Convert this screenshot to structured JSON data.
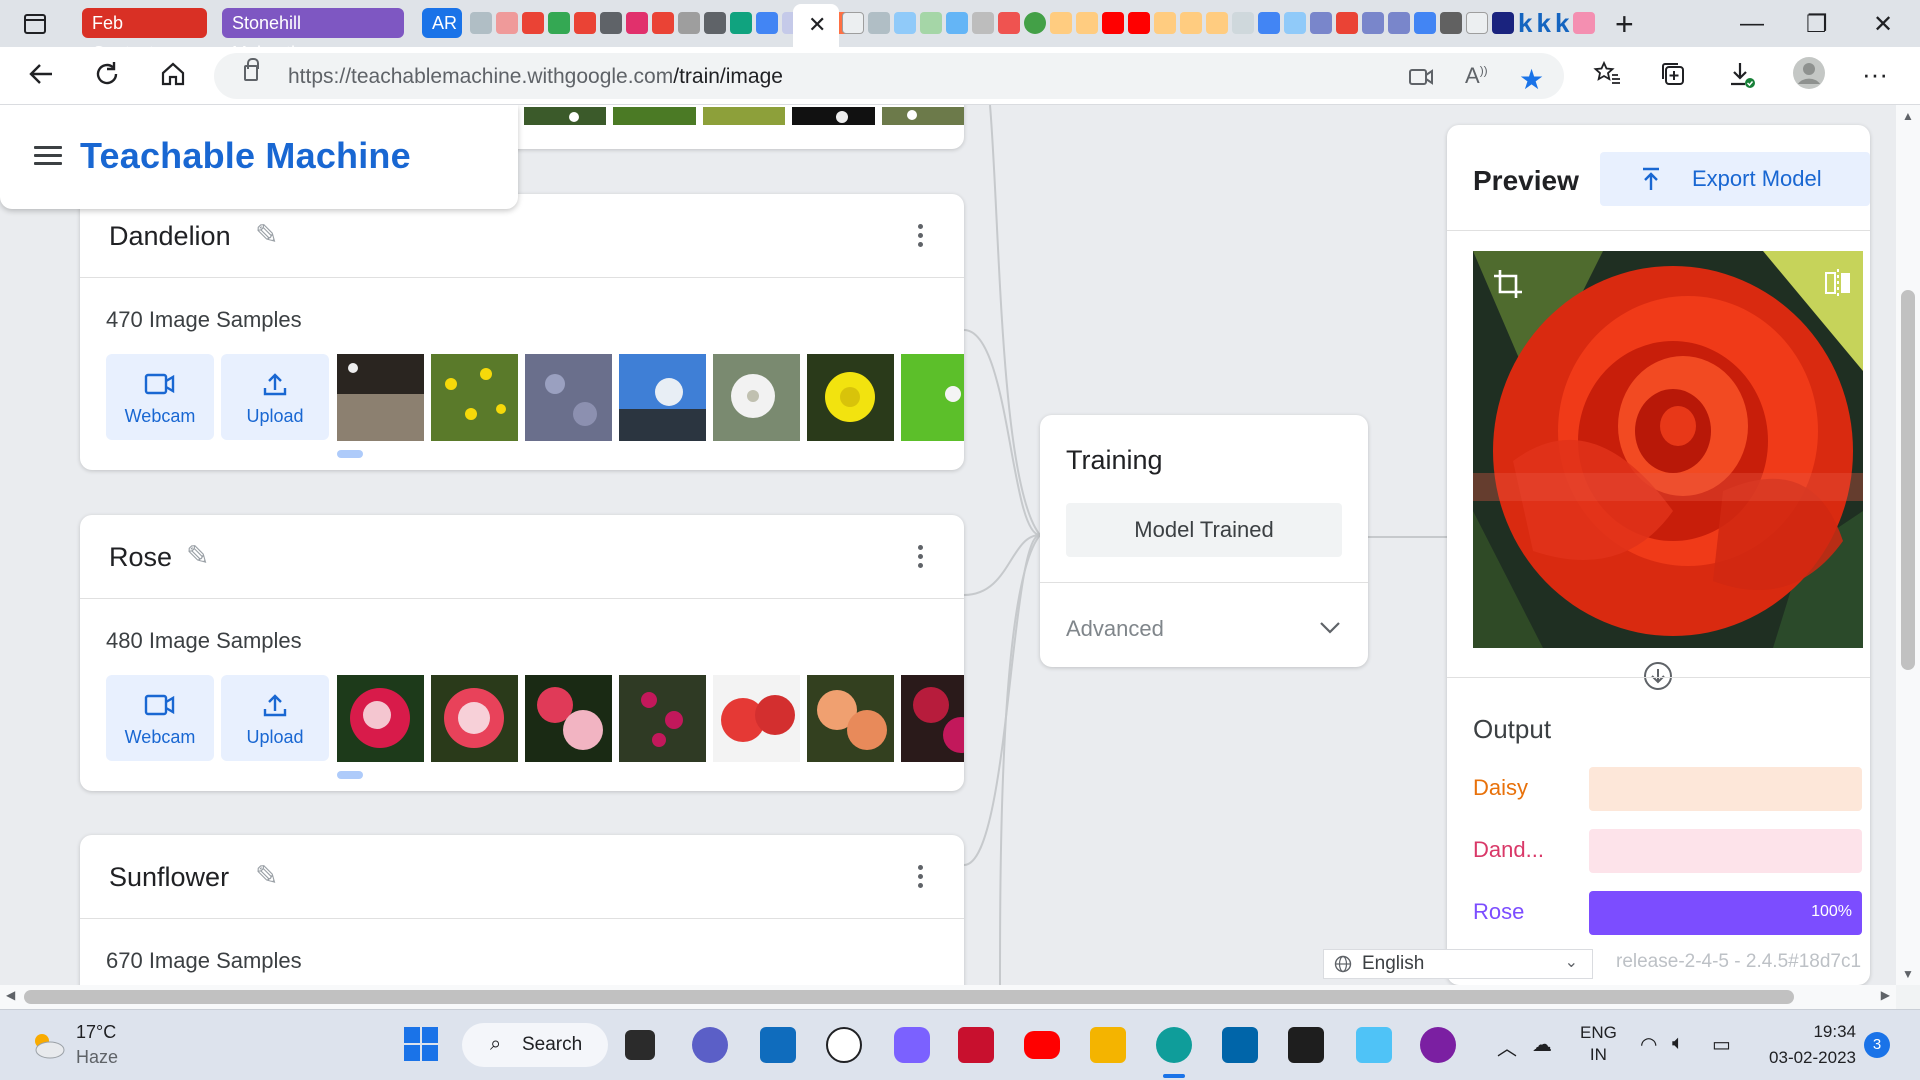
{
  "browser": {
    "tab_groups": [
      {
        "label": "Feb Contests",
        "color": "#d93025"
      },
      {
        "label": "Stonehill Makeathon",
        "color": "#7e57c2"
      },
      {
        "label": "AR",
        "color": "#1a73e8"
      }
    ],
    "active_tab_close": "✕",
    "url_host": "https://teachablemachine.withgoogle.com",
    "url_path": "/train/image",
    "new_tab_label": "+"
  },
  "app": {
    "brand": "Teachable Machine",
    "accent": "#1967d2"
  },
  "classes": [
    {
      "name": "Dandelion",
      "samples": "470 Image Samples",
      "webcam_label": "Webcam",
      "upload_label": "Upload"
    },
    {
      "name": "Rose",
      "samples": "480 Image Samples",
      "webcam_label": "Webcam",
      "upload_label": "Upload"
    },
    {
      "name": "Sunflower",
      "samples": "670 Image Samples"
    }
  ],
  "training": {
    "title": "Training",
    "status_button": "Model Trained",
    "advanced_label": "Advanced"
  },
  "preview": {
    "title": "Preview",
    "export_label": "Export Model",
    "output_title": "Output",
    "outputs": [
      {
        "label": "Daisy",
        "color": "#e8710a",
        "track": "#fde7d9",
        "fraction": 0.0,
        "pct": ""
      },
      {
        "label": "Dand...",
        "color": "#d93868",
        "track": "#fde3ea",
        "fraction": 0.0,
        "pct": ""
      },
      {
        "label": "Rose",
        "color": "#7c4dff",
        "track": "#ede7ff",
        "fraction": 1.0,
        "pct": "100%"
      }
    ]
  },
  "footer": {
    "language": "English",
    "release": "release-2-4-5 - 2.4.5#18d7c1"
  },
  "taskbar": {
    "temperature": "17°C",
    "weather": "Haze",
    "search_label": "Search",
    "lang_top": "ENG",
    "lang_bottom": "IN",
    "time": "19:34",
    "date": "03-02-2023",
    "notifications": "3"
  }
}
